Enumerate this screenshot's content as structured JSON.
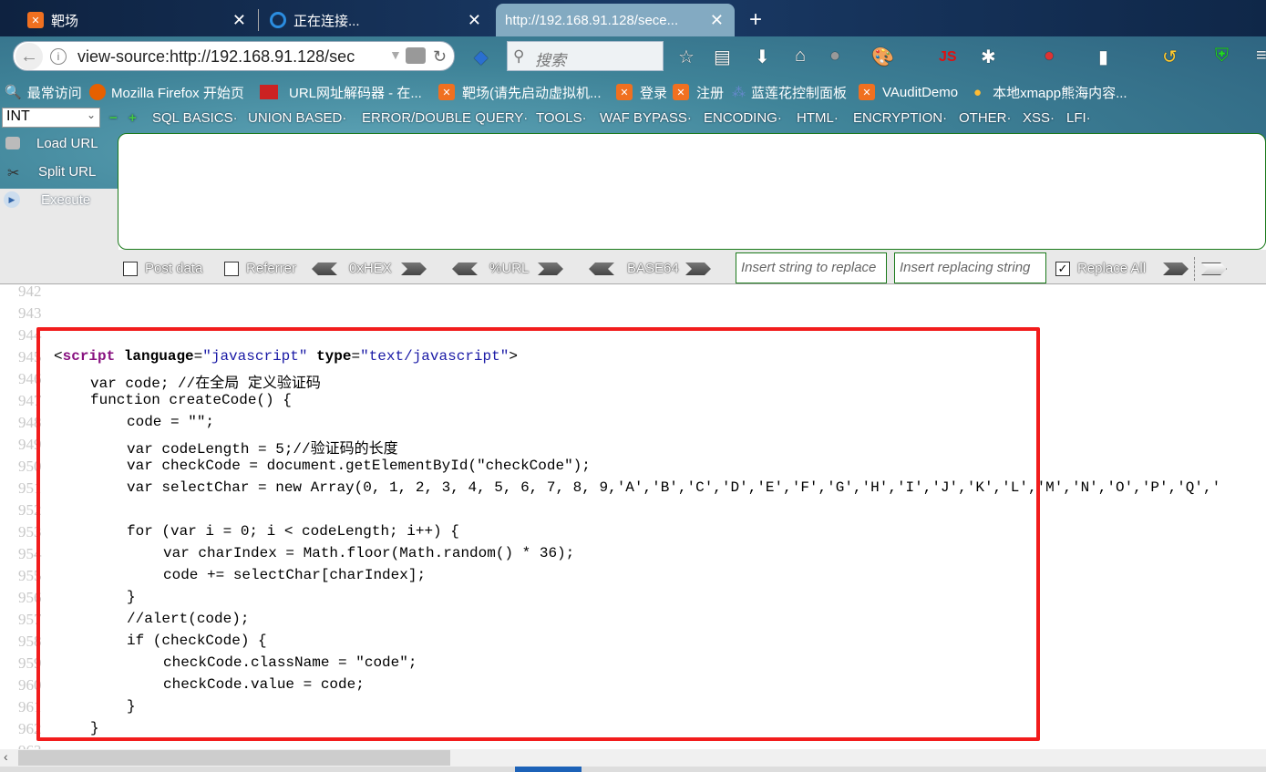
{
  "tabs": [
    {
      "label": "靶场",
      "icon": "xampp-icon"
    },
    {
      "label": "正在连接...",
      "icon": "loading-icon"
    },
    {
      "label": "http://192.168.91.128/sece...",
      "icon": "none",
      "active": true
    }
  ],
  "new_tab": "+",
  "close": "✕",
  "url": "view-source:http://192.168.91.128/sec",
  "search_placeholder": "搜索",
  "toolbar_js": "JS",
  "bookmarks": [
    "最常访问",
    "Mozilla Firefox 开始页",
    "URL网址解码器 - 在...",
    "靶场(请先启动虚拟机...",
    "登录",
    "注册",
    "蓝莲花控制面板",
    "VAuditDemo",
    "本地xmapp熊海内容..."
  ],
  "hackbar": {
    "select": "INT",
    "menus": [
      "SQL BASICS",
      "UNION BASED",
      "ERROR/DOUBLE QUERY",
      "TOOLS",
      "WAF BYPASS",
      "ENCODING",
      "HTML",
      "ENCRYPTION",
      "OTHER",
      "XSS",
      "LFI"
    ],
    "load_url": "Load URL",
    "split_url": "Split URL",
    "execute": "Execute",
    "post_data": "Post data",
    "referrer": "Referrer",
    "hex": "0xHEX",
    "url_enc": "%URL",
    "base64": "BASE64",
    "replace_placeholder": "Insert string to replace",
    "replacing_placeholder": "Insert replacing string",
    "replace_all": "Replace All",
    "replace_all_checked": true
  },
  "source": {
    "line_numbers": [
      "942",
      "943",
      "944",
      "945",
      "946",
      "947",
      "948",
      "949",
      "950",
      "951",
      "952",
      "953",
      "954",
      "955",
      "956",
      "957",
      "958",
      "959",
      "960",
      "961",
      "962",
      "963"
    ],
    "lines": [
      {
        "n": 945,
        "tokens": [
          [
            "<",
            ""
          ],
          [
            "script",
            "tag"
          ],
          [
            " ",
            ""
          ],
          [
            "language",
            "attr"
          ],
          [
            "=",
            ""
          ],
          [
            "\"javascript\"",
            "val"
          ],
          [
            " ",
            ""
          ],
          [
            "type",
            "attr"
          ],
          [
            "=",
            ""
          ],
          [
            "\"text/javascript\"",
            "val"
          ],
          [
            ">",
            ""
          ]
        ]
      },
      {
        "n": 946,
        "indent": 1,
        "text": "var code; //在全局 定义验证码"
      },
      {
        "n": 947,
        "indent": 1,
        "text": "function createCode() {"
      },
      {
        "n": 948,
        "indent": 2,
        "text": "code = \"\";"
      },
      {
        "n": 949,
        "indent": 2,
        "text": "var codeLength = 5;//验证码的长度"
      },
      {
        "n": 950,
        "indent": 2,
        "text": "var checkCode = document.getElementById(\"checkCode\");"
      },
      {
        "n": 951,
        "indent": 2,
        "text": "var selectChar = new Array(0, 1, 2, 3, 4, 5, 6, 7, 8, 9,'A','B','C','D','E','F','G','H','I','J','K','L','M','N','O','P','Q','"
      },
      {
        "n": 953,
        "indent": 2,
        "text": "for (var i = 0; i < codeLength; i++) {"
      },
      {
        "n": 954,
        "indent": 3,
        "text": "var charIndex = Math.floor(Math.random() * 36);"
      },
      {
        "n": 955,
        "indent": 3,
        "text": "code += selectChar[charIndex];"
      },
      {
        "n": 956,
        "indent": 2,
        "text": "}"
      },
      {
        "n": 957,
        "indent": 2,
        "text": "//alert(code);"
      },
      {
        "n": 958,
        "indent": 2,
        "text": "if (checkCode) {"
      },
      {
        "n": 959,
        "indent": 3,
        "text": "checkCode.className = \"code\";"
      },
      {
        "n": 960,
        "indent": 3,
        "text": "checkCode.value = code;"
      },
      {
        "n": 961,
        "indent": 2,
        "text": "}"
      },
      {
        "n": 962,
        "indent": 1,
        "text": "}"
      }
    ]
  },
  "highlight_color": "#f21c1c"
}
